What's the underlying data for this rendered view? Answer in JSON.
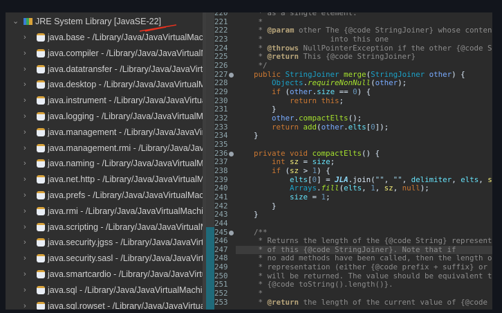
{
  "tree": {
    "root": {
      "label": "JRE System Library [JavaSE-22]",
      "icon": "library-icon",
      "expanded": true
    },
    "items": [
      "java.base - /Library/Java/JavaVirtualMachines",
      "java.compiler - /Library/Java/JavaVirtualMachines",
      "java.datatransfer - /Library/Java/JavaVirtualMachines",
      "java.desktop - /Library/Java/JavaVirtualMachines",
      "java.instrument - /Library/Java/JavaVirtualMachines",
      "java.logging - /Library/Java/JavaVirtualMachines",
      "java.management - /Library/Java/JavaVirtualMachines",
      "java.management.rmi - /Library/Java/JavaVirtualMachines",
      "java.naming - /Library/Java/JavaVirtualMachines",
      "java.net.http - /Library/Java/JavaVirtualMachines",
      "java.prefs - /Library/Java/JavaVirtualMachines",
      "java.rmi - /Library/Java/JavaVirtualMachines",
      "java.scripting - /Library/Java/JavaVirtualMachines",
      "java.security.jgss - /Library/Java/JavaVirtualMachines",
      "java.security.sasl - /Library/Java/JavaVirtualMachines",
      "java.smartcardio - /Library/Java/JavaVirtualMachines",
      "java.sql - /Library/Java/JavaVirtualMachines",
      "java.sql.rowset - /Library/Java/JavaVirtualMachines"
    ]
  },
  "editor": {
    "current_line": 247,
    "lines": [
      {
        "n": 220,
        "t": [
          [
            "     * as a single element.",
            "cm"
          ]
        ]
      },
      {
        "n": 221,
        "t": [
          [
            "     *",
            "cm"
          ]
        ]
      },
      {
        "n": 222,
        "t": [
          [
            "     * ",
            "cm"
          ],
          [
            "@param",
            "tag"
          ],
          [
            " other The {@code StringJoiner} whose contents should be merged",
            "cm"
          ]
        ]
      },
      {
        "n": 223,
        "t": [
          [
            "     *               into this one",
            "cm"
          ]
        ]
      },
      {
        "n": 224,
        "t": [
          [
            "     * ",
            "cm"
          ],
          [
            "@throws",
            "tag"
          ],
          [
            " NullPointerException if the other {@code StringJoiner} is null",
            "cm"
          ]
        ]
      },
      {
        "n": 225,
        "t": [
          [
            "     * ",
            "cm"
          ],
          [
            "@return",
            "tag"
          ],
          [
            " This {@code StringJoiner}",
            "cm"
          ]
        ]
      },
      {
        "n": 226,
        "t": [
          [
            "     */",
            "cm"
          ]
        ]
      },
      {
        "n": 227,
        "fold": true,
        "t": [
          [
            "    ",
            ""
          ],
          [
            "public ",
            "kw"
          ],
          [
            "StringJoiner ",
            "ty"
          ],
          [
            "merge",
            "md"
          ],
          [
            "(",
            ""
          ],
          [
            "StringJoiner ",
            "ty"
          ],
          [
            "other",
            "va"
          ],
          [
            ") {",
            ""
          ]
        ]
      },
      {
        "n": 228,
        "t": [
          [
            "        ",
            ""
          ],
          [
            "Objects",
            "ty"
          ],
          [
            ".",
            ""
          ],
          [
            "requireNonNull",
            "mi"
          ],
          [
            "(",
            ""
          ],
          [
            "other",
            "va"
          ],
          [
            ");",
            ""
          ]
        ]
      },
      {
        "n": 229,
        "t": [
          [
            "        ",
            ""
          ],
          [
            "if ",
            "kw"
          ],
          [
            "(",
            ""
          ],
          [
            "other",
            "va"
          ],
          [
            ".",
            ""
          ],
          [
            "size",
            "fd"
          ],
          [
            " == ",
            ""
          ],
          [
            "0",
            "nu"
          ],
          [
            ") {",
            ""
          ]
        ]
      },
      {
        "n": 230,
        "t": [
          [
            "            ",
            ""
          ],
          [
            "return this",
            "kw"
          ],
          [
            ";",
            ""
          ]
        ]
      },
      {
        "n": 231,
        "t": [
          [
            "        }",
            ""
          ]
        ]
      },
      {
        "n": 232,
        "t": [
          [
            "        ",
            ""
          ],
          [
            "other",
            "va"
          ],
          [
            ".",
            ""
          ],
          [
            "compactElts",
            "md"
          ],
          [
            "();",
            ""
          ]
        ]
      },
      {
        "n": 233,
        "t": [
          [
            "        ",
            ""
          ],
          [
            "return ",
            "kw"
          ],
          [
            "add",
            "md"
          ],
          [
            "(",
            ""
          ],
          [
            "other",
            "va"
          ],
          [
            ".",
            ""
          ],
          [
            "elts",
            "fd"
          ],
          [
            "[",
            ""
          ],
          [
            "0",
            "nu"
          ],
          [
            "]);",
            ""
          ]
        ]
      },
      {
        "n": 234,
        "t": [
          [
            "    }",
            ""
          ]
        ]
      },
      {
        "n": 235,
        "t": []
      },
      {
        "n": 236,
        "fold": true,
        "t": [
          [
            "    ",
            ""
          ],
          [
            "private void ",
            "kw"
          ],
          [
            "compactElts",
            "md"
          ],
          [
            "() {",
            ""
          ]
        ]
      },
      {
        "n": 237,
        "t": [
          [
            "        ",
            ""
          ],
          [
            "int ",
            "kw"
          ],
          [
            "sz",
            "lv"
          ],
          [
            " = ",
            ""
          ],
          [
            "size",
            "fd"
          ],
          [
            ";",
            ""
          ]
        ]
      },
      {
        "n": 238,
        "t": [
          [
            "        ",
            ""
          ],
          [
            "if ",
            "kw"
          ],
          [
            "(",
            ""
          ],
          [
            "sz",
            "lv"
          ],
          [
            " > ",
            ""
          ],
          [
            "1",
            "nu"
          ],
          [
            ") {",
            ""
          ]
        ]
      },
      {
        "n": 239,
        "t": [
          [
            "            ",
            ""
          ],
          [
            "elts",
            "fd"
          ],
          [
            "[",
            ""
          ],
          [
            "0",
            "nu"
          ],
          [
            "] = ",
            ""
          ],
          [
            "JLA",
            "sf"
          ],
          [
            ".join(",
            ""
          ],
          [
            "\"\"",
            "st"
          ],
          [
            ", ",
            ""
          ],
          [
            "\"\"",
            "st"
          ],
          [
            ", ",
            ""
          ],
          [
            "delimiter",
            "fd"
          ],
          [
            ", ",
            ""
          ],
          [
            "elts",
            "fd"
          ],
          [
            ", ",
            ""
          ],
          [
            "sz",
            "lv"
          ],
          [
            ");",
            ""
          ]
        ]
      },
      {
        "n": 240,
        "t": [
          [
            "            ",
            ""
          ],
          [
            "Arrays",
            "ty"
          ],
          [
            ".",
            ""
          ],
          [
            "fill",
            "mi"
          ],
          [
            "(",
            ""
          ],
          [
            "elts",
            "fd"
          ],
          [
            ", ",
            ""
          ],
          [
            "1",
            "nu"
          ],
          [
            ", ",
            ""
          ],
          [
            "sz",
            "lv"
          ],
          [
            ", ",
            ""
          ],
          [
            "null",
            "kw"
          ],
          [
            ");",
            ""
          ]
        ]
      },
      {
        "n": 241,
        "t": [
          [
            "            ",
            ""
          ],
          [
            "size",
            "fd"
          ],
          [
            " = ",
            ""
          ],
          [
            "1",
            "nu"
          ],
          [
            ";",
            ""
          ]
        ]
      },
      {
        "n": 242,
        "t": [
          [
            "        }",
            ""
          ]
        ]
      },
      {
        "n": 243,
        "t": [
          [
            "    }",
            ""
          ]
        ]
      },
      {
        "n": 244,
        "t": []
      },
      {
        "n": 245,
        "fold": true,
        "t": [
          [
            "    /**",
            "cm"
          ]
        ]
      },
      {
        "n": 246,
        "t": [
          [
            "     * Returns the length of the {@code String} representation",
            "cm"
          ]
        ]
      },
      {
        "n": 247,
        "t": [
          [
            "     * of this {@code StringJoiner}. Note that if",
            "cm"
          ]
        ]
      },
      {
        "n": 248,
        "t": [
          [
            "     * no add methods have been called, then the length of the {@code String}",
            "cm"
          ]
        ]
      },
      {
        "n": 249,
        "t": [
          [
            "     * representation (either {@code prefix + suffix} or {@code emptyValue})",
            "cm"
          ]
        ]
      },
      {
        "n": 250,
        "t": [
          [
            "     * will be returned. The value should be equivalent to",
            "cm"
          ]
        ]
      },
      {
        "n": 251,
        "t": [
          [
            "     * {@code toString().length()}.",
            "cm"
          ]
        ]
      },
      {
        "n": 252,
        "t": [
          [
            "     *",
            "cm"
          ]
        ]
      },
      {
        "n": 253,
        "t": [
          [
            "     * ",
            "cm"
          ],
          [
            "@return",
            "tag"
          ],
          [
            " the length of the current value of {@code StringJoiner}",
            "cm"
          ]
        ]
      }
    ]
  },
  "annotation": {
    "color": "#e8321f"
  }
}
